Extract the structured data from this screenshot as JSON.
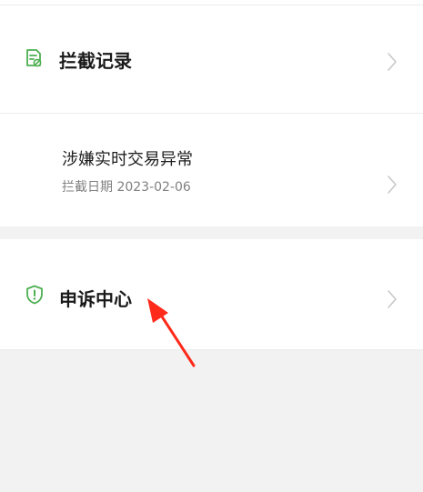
{
  "section_records": {
    "title": "拦截记录",
    "icon": "record-check-icon",
    "accent": "#4CAF50"
  },
  "record_item": {
    "title": "涉嫌实时交易异常",
    "date_label": "拦截日期",
    "date": "2023-02-06",
    "date_line": "拦截日期 2023-02-06"
  },
  "section_appeal": {
    "title": "申诉中心",
    "icon": "shield-alert-icon",
    "accent": "#4CAF50"
  },
  "annotation": {
    "arrow_color": "#ff2a1a",
    "arrow_icon": "red-arrow-icon"
  }
}
